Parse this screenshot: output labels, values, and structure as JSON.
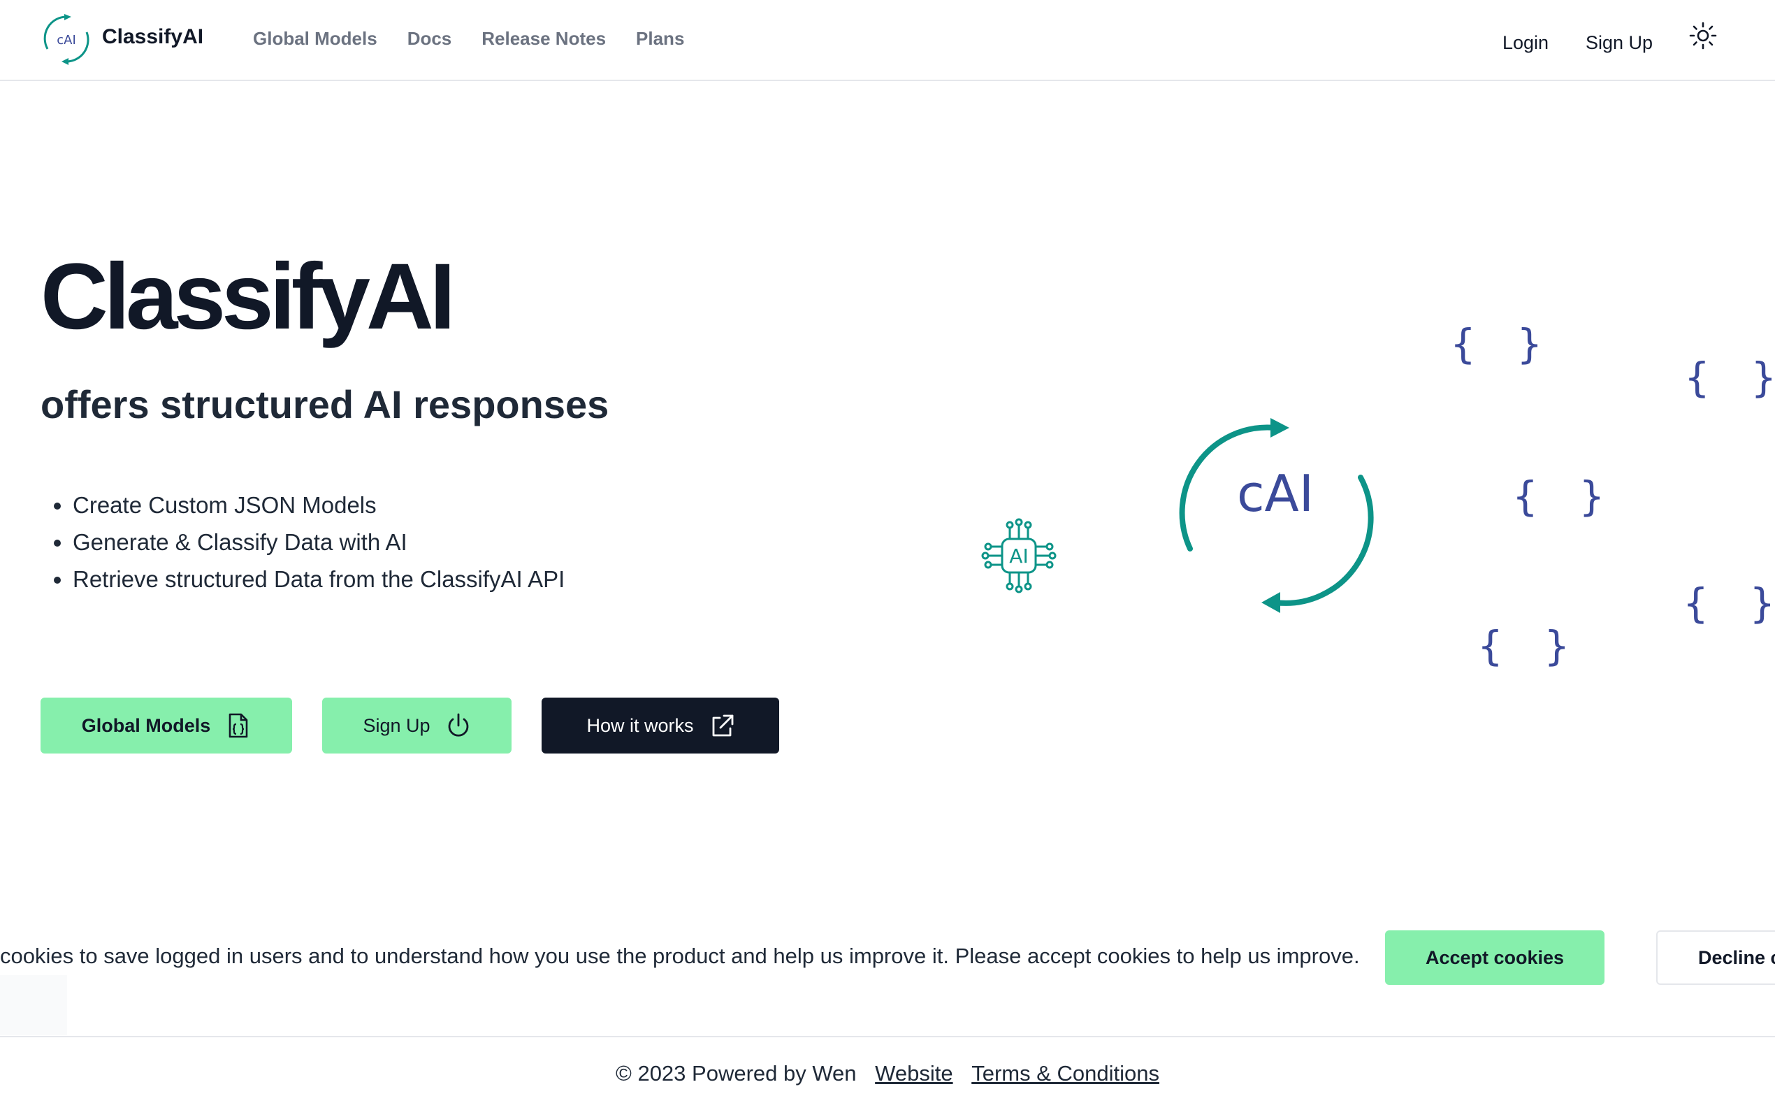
{
  "header": {
    "logo_text": "cAI",
    "brand": "ClassifyAI",
    "nav": [
      "Global Models",
      "Docs",
      "Release Notes",
      "Plans"
    ],
    "login": "Login",
    "signup": "Sign Up"
  },
  "hero": {
    "title": "ClassifyAI",
    "subtitle": "offers structured AI responses",
    "features": [
      "Create Custom JSON Models",
      "Generate & Classify Data with AI",
      "Retrieve structured Data from the ClassifyAI API"
    ],
    "buttons": {
      "global_models": "Global Models",
      "sign_up": "Sign Up",
      "how_it_works": "How it works"
    }
  },
  "illustration": {
    "center_text": "cAI",
    "chip_text": "AI",
    "braces": "{ }"
  },
  "cookie_banner": {
    "text": "cookies to save logged in users and to understand how you use the product and help us improve it. Please accept cookies to help us improve.",
    "accept": "Accept cookies",
    "decline": "Decline c"
  },
  "footer": {
    "text": "© 2023 Powered by Wen",
    "website": "Website",
    "terms": "Terms & Conditions"
  },
  "colors": {
    "accent_green": "#86efac",
    "dark": "#111827",
    "teal": "#0d9488",
    "brace_blue": "#3b4a9a"
  }
}
